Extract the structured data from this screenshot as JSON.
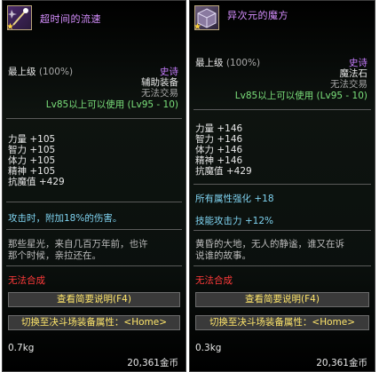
{
  "left": {
    "name": "超时间的流速",
    "grade": "最上级",
    "grade_pct": "(100%)",
    "rarity": "史诗",
    "item_type": "辅助装备",
    "trade": "无法交易",
    "level_req": "Lv85以上可以使用 (Lv95 - 10)",
    "stats": [
      {
        "label": "力量",
        "value": "+105"
      },
      {
        "label": "智力",
        "value": "+105"
      },
      {
        "label": "体力",
        "value": "+105"
      },
      {
        "label": "精神",
        "value": "+105"
      },
      {
        "label": "抗魔值",
        "value": "+429"
      }
    ],
    "effect": "攻击时，附加18%的伤害。",
    "flavor_line1": "那些星光，来自几百万年前，也许",
    "flavor_line2": "那个时候，亲拉还在。",
    "no_synth": "无法合成",
    "btn_brief": "查看简要说明(F4)",
    "btn_switch": "切换至决斗场装备属性：<Home>",
    "weight": "0.7kg",
    "price": "20,361金币"
  },
  "right": {
    "name": "异次元的魔方",
    "grade": "最上级",
    "grade_pct": "(100%)",
    "rarity": "史诗",
    "item_type": "魔法石",
    "trade": "无法交易",
    "level_req": "Lv85以上可以使用 (Lv95 - 10)",
    "stats": [
      {
        "label": "力量",
        "value": "+146"
      },
      {
        "label": "智力",
        "value": "+146"
      },
      {
        "label": "体力",
        "value": "+146"
      },
      {
        "label": "精神",
        "value": "+146"
      },
      {
        "label": "抗魔值",
        "value": "+429"
      }
    ],
    "effect1": "所有属性强化 +18",
    "effect2": "技能攻击力 +12%",
    "flavor_line1": "黄昏的大地，无人的静谧，谁又在诉",
    "flavor_line2": "说谁的故事。",
    "no_synth": "无法合成",
    "btn_brief": "查看简要说明(F4)",
    "btn_switch": "切换至决斗场装备属性：<Home>",
    "weight": "0.3kg",
    "price": "20,361金币"
  },
  "colors": {
    "name": "#d68fff",
    "rarity": "#c77dff",
    "level": "#7be07b",
    "effect": "#7fd3f0",
    "no_synth": "#ff3a3a",
    "button_text": "#ffe66b"
  },
  "icons": {
    "left": "wand-icon",
    "right": "cube-icon",
    "star": "star-icon"
  }
}
